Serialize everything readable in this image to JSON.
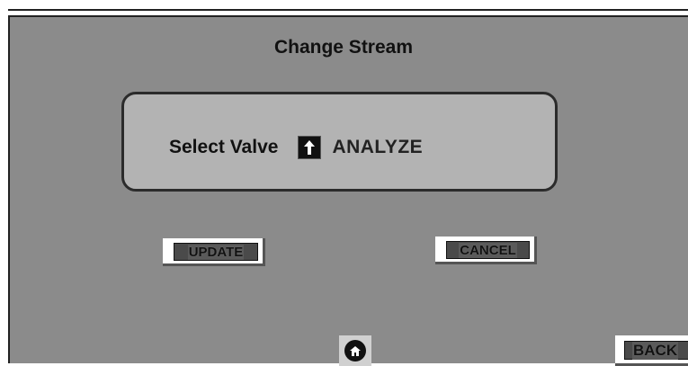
{
  "header": {
    "title": "Change Stream"
  },
  "panel": {
    "select_label": "Select Valve",
    "arrow_icon": "up-arrow-icon",
    "value": "ANALYZE"
  },
  "buttons": {
    "update_label": "UPDATE",
    "cancel_label": "CANCEL",
    "back_label": "BACK",
    "home_icon": "home-icon"
  },
  "colors": {
    "background": "#8b8b8b",
    "panel": "#b3b3b3",
    "button_face": "#4a4a4a"
  }
}
